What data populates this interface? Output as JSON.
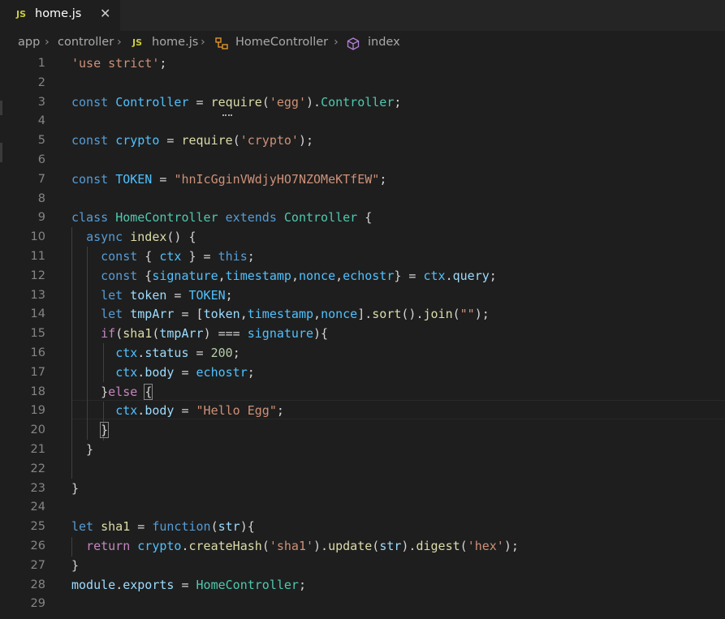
{
  "tab": {
    "icon": "JS",
    "filename": "home.js",
    "close": "✕"
  },
  "breadcrumb": {
    "items": [
      "app",
      "controller",
      "home.js",
      "HomeController",
      "index"
    ],
    "separator": "›",
    "js_icon": "JS"
  },
  "editor": {
    "line_numbers": [
      "1",
      "2",
      "3",
      "4",
      "5",
      "6",
      "7",
      "8",
      "9",
      "10",
      "11",
      "12",
      "13",
      "14",
      "15",
      "16",
      "17",
      "18",
      "19",
      "20",
      "21",
      "22",
      "23",
      "24",
      "25",
      "26",
      "27",
      "28",
      "29"
    ],
    "lines": [
      [
        [
          "str",
          "'use strict'"
        ],
        [
          "p",
          ";"
        ]
      ],
      [],
      [
        [
          "kw",
          "const"
        ],
        [
          "p",
          " "
        ],
        [
          "cst",
          "Controller"
        ],
        [
          "p",
          " = "
        ],
        [
          "fn",
          "require"
        ],
        [
          "p",
          "("
        ],
        [
          "str",
          "'egg'"
        ],
        [
          "p",
          ")."
        ],
        [
          "cls",
          "Controller"
        ],
        [
          "p",
          ";"
        ]
      ],
      [],
      [
        [
          "kw",
          "const"
        ],
        [
          "p",
          " "
        ],
        [
          "cst",
          "crypto"
        ],
        [
          "p",
          " = "
        ],
        [
          "fn",
          "require"
        ],
        [
          "p",
          "("
        ],
        [
          "str",
          "'crypto'"
        ],
        [
          "p",
          ");"
        ]
      ],
      [],
      [
        [
          "kw",
          "const"
        ],
        [
          "p",
          " "
        ],
        [
          "cst",
          "TOKEN"
        ],
        [
          "p",
          " = "
        ],
        [
          "str",
          "\"hnIcGginVWdjyHO7NZOMeKTfEW\""
        ],
        [
          "p",
          ";"
        ]
      ],
      [],
      [
        [
          "kw",
          "class"
        ],
        [
          "p",
          " "
        ],
        [
          "cls",
          "HomeController"
        ],
        [
          "p",
          " "
        ],
        [
          "kw",
          "extends"
        ],
        [
          "p",
          " "
        ],
        [
          "cls",
          "Controller"
        ],
        [
          "p",
          " {"
        ]
      ],
      [
        [
          "p",
          "  "
        ],
        [
          "kw",
          "async"
        ],
        [
          "p",
          " "
        ],
        [
          "fn",
          "index"
        ],
        [
          "p",
          "() {"
        ]
      ],
      [
        [
          "p",
          "    "
        ],
        [
          "kw",
          "const"
        ],
        [
          "p",
          " { "
        ],
        [
          "cst",
          "ctx"
        ],
        [
          "p",
          " } = "
        ],
        [
          "kw",
          "this"
        ],
        [
          "p",
          ";"
        ]
      ],
      [
        [
          "p",
          "    "
        ],
        [
          "kw",
          "const"
        ],
        [
          "p",
          " {"
        ],
        [
          "cst",
          "signature"
        ],
        [
          "p",
          ","
        ],
        [
          "cst",
          "timestamp"
        ],
        [
          "p",
          ","
        ],
        [
          "cst",
          "nonce"
        ],
        [
          "p",
          ","
        ],
        [
          "cst",
          "echostr"
        ],
        [
          "p",
          "} = "
        ],
        [
          "cst",
          "ctx"
        ],
        [
          "p",
          "."
        ],
        [
          "var",
          "query"
        ],
        [
          "p",
          ";"
        ]
      ],
      [
        [
          "p",
          "    "
        ],
        [
          "kw",
          "let"
        ],
        [
          "p",
          " "
        ],
        [
          "var",
          "token"
        ],
        [
          "p",
          " = "
        ],
        [
          "cst",
          "TOKEN"
        ],
        [
          "p",
          ";"
        ]
      ],
      [
        [
          "p",
          "    "
        ],
        [
          "kw",
          "let"
        ],
        [
          "p",
          " "
        ],
        [
          "var",
          "tmpArr"
        ],
        [
          "p",
          " = ["
        ],
        [
          "var",
          "token"
        ],
        [
          "p",
          ","
        ],
        [
          "cst",
          "timestamp"
        ],
        [
          "p",
          ","
        ],
        [
          "cst",
          "nonce"
        ],
        [
          "p",
          "]."
        ],
        [
          "fn",
          "sort"
        ],
        [
          "p",
          "()."
        ],
        [
          "fn",
          "join"
        ],
        [
          "p",
          "("
        ],
        [
          "str",
          "\"\""
        ],
        [
          "p",
          ");"
        ]
      ],
      [
        [
          "p",
          "    "
        ],
        [
          "ctl",
          "if"
        ],
        [
          "p",
          "("
        ],
        [
          "fn",
          "sha1"
        ],
        [
          "p",
          "("
        ],
        [
          "var",
          "tmpArr"
        ],
        [
          "p",
          ") === "
        ],
        [
          "cst",
          "signature"
        ],
        [
          "p",
          "){"
        ]
      ],
      [
        [
          "p",
          "      "
        ],
        [
          "cst",
          "ctx"
        ],
        [
          "p",
          "."
        ],
        [
          "var",
          "status"
        ],
        [
          "p",
          " = "
        ],
        [
          "num",
          "200"
        ],
        [
          "p",
          ";"
        ]
      ],
      [
        [
          "p",
          "      "
        ],
        [
          "cst",
          "ctx"
        ],
        [
          "p",
          "."
        ],
        [
          "var",
          "body"
        ],
        [
          "p",
          " = "
        ],
        [
          "cst",
          "echostr"
        ],
        [
          "p",
          ";"
        ]
      ],
      [
        [
          "p",
          "    }"
        ],
        [
          "ctl",
          "else"
        ],
        [
          "p",
          " "
        ],
        [
          "b",
          "{"
        ]
      ],
      [
        [
          "p",
          "      "
        ],
        [
          "cst",
          "ctx"
        ],
        [
          "p",
          "."
        ],
        [
          "var",
          "body"
        ],
        [
          "p",
          " = "
        ],
        [
          "str",
          "\"Hello Egg\""
        ],
        [
          "p",
          ";"
        ]
      ],
      [
        [
          "p",
          "    "
        ],
        [
          "b",
          "}"
        ]
      ],
      [
        [
          "p",
          "  }"
        ]
      ],
      [],
      [
        [
          "p",
          "}"
        ]
      ],
      [],
      [
        [
          "kw",
          "let"
        ],
        [
          "p",
          " "
        ],
        [
          "fn",
          "sha1"
        ],
        [
          "p",
          " = "
        ],
        [
          "kw",
          "function"
        ],
        [
          "p",
          "("
        ],
        [
          "var",
          "str"
        ],
        [
          "p",
          "){"
        ]
      ],
      [
        [
          "p",
          "  "
        ],
        [
          "ctl",
          "return"
        ],
        [
          "p",
          " "
        ],
        [
          "cst",
          "crypto"
        ],
        [
          "p",
          "."
        ],
        [
          "fn",
          "createHash"
        ],
        [
          "p",
          "("
        ],
        [
          "str",
          "'sha1'"
        ],
        [
          "p",
          ")."
        ],
        [
          "fn",
          "update"
        ],
        [
          "p",
          "("
        ],
        [
          "var",
          "str"
        ],
        [
          "p",
          ")."
        ],
        [
          "fn",
          "digest"
        ],
        [
          "p",
          "("
        ],
        [
          "str",
          "'hex'"
        ],
        [
          "p",
          ");"
        ]
      ],
      [
        [
          "p",
          "}"
        ]
      ],
      [
        [
          "var",
          "module"
        ],
        [
          "p",
          "."
        ],
        [
          "var",
          "exports"
        ],
        [
          "p",
          " = "
        ],
        [
          "cls",
          "HomeController"
        ],
        [
          "p",
          ";"
        ]
      ],
      []
    ]
  },
  "colors": {
    "background": "#1e1e1e",
    "keyword": "#569cd6",
    "control": "#c586c0",
    "string": "#ce9178",
    "number": "#b5cea8",
    "class": "#4ec9b0",
    "function": "#dcdcaa",
    "variable": "#9cdcfe",
    "constant": "#4fc1ff",
    "js_icon": "#cbcb41"
  }
}
